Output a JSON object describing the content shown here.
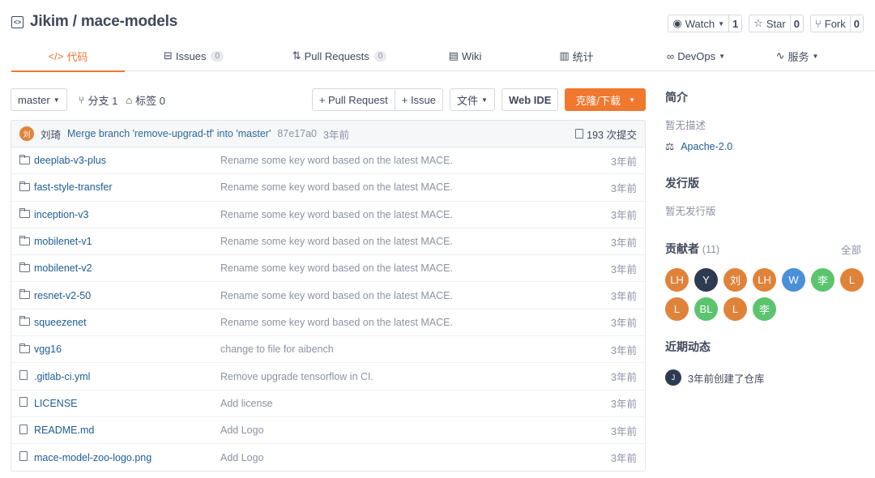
{
  "repo": {
    "title": "Jikim / mace-models",
    "watch_label": "Watch",
    "watch_count": "1",
    "star_label": "Star",
    "star_count": "0",
    "fork_label": "Fork",
    "fork_count": "0"
  },
  "tabs": [
    {
      "icon": "code-icon",
      "label": "代码",
      "badge": ""
    },
    {
      "icon": "issues-icon",
      "label": "Issues",
      "badge": "0"
    },
    {
      "icon": "pull-request-icon",
      "label": "Pull Requests",
      "badge": "0"
    },
    {
      "icon": "wiki-icon",
      "label": "Wiki",
      "badge": ""
    },
    {
      "icon": "stats-icon",
      "label": "统计",
      "badge": ""
    },
    {
      "icon": "devops-icon",
      "label": "DevOps",
      "badge": ""
    },
    {
      "icon": "service-icon",
      "label": "服务",
      "badge": ""
    }
  ],
  "toolbar": {
    "branch": "master",
    "branches_label": "分支 1",
    "tags_label": "标签 0",
    "pull_request_label": "+ Pull Request",
    "issue_label": "+ Issue",
    "file_label": "文件",
    "webide_label": "Web IDE",
    "clone_label": "克隆/下载"
  },
  "commit": {
    "avatar": "刘",
    "author": "刘琦",
    "message": "Merge branch 'remove-upgrad-tf' into 'master'",
    "hash": "87e17a0",
    "time": "3年前",
    "count_label": "193 次提交"
  },
  "files": [
    {
      "type": "folder",
      "name": "deeplab-v3-plus",
      "message": "Rename some key word based on the latest MACE.",
      "time": "3年前"
    },
    {
      "type": "folder",
      "name": "fast-style-transfer",
      "message": "Rename some key word based on the latest MACE.",
      "time": "3年前"
    },
    {
      "type": "folder",
      "name": "inception-v3",
      "message": "Rename some key word based on the latest MACE.",
      "time": "3年前"
    },
    {
      "type": "folder",
      "name": "mobilenet-v1",
      "message": "Rename some key word based on the latest MACE.",
      "time": "3年前"
    },
    {
      "type": "folder",
      "name": "mobilenet-v2",
      "message": "Rename some key word based on the latest MACE.",
      "time": "3年前"
    },
    {
      "type": "folder",
      "name": "resnet-v2-50",
      "message": "Rename some key word based on the latest MACE.",
      "time": "3年前"
    },
    {
      "type": "folder",
      "name": "squeezenet",
      "message": "Rename some key word based on the latest MACE.",
      "time": "3年前"
    },
    {
      "type": "folder",
      "name": "vgg16",
      "message": "change to file for aibench",
      "time": "3年前"
    },
    {
      "type": "file",
      "name": ".gitlab-ci.yml",
      "message": "Remove upgrade tensorflow in CI.",
      "time": "3年前"
    },
    {
      "type": "file",
      "name": "LICENSE",
      "message": "Add license",
      "time": "3年前"
    },
    {
      "type": "file",
      "name": "README.md",
      "message": "Add Logo",
      "time": "3年前"
    },
    {
      "type": "file",
      "name": "mace-model-zoo-logo.png",
      "message": "Add Logo",
      "time": "3年前"
    }
  ],
  "sidebar": {
    "intro_title": "简介",
    "intro_text": "暂无描述",
    "license": "Apache-2.0",
    "release_title": "发行版",
    "release_text": "暂无发行版",
    "contributors_title": "贡献者",
    "contributors_count": "(11)",
    "contributors_all": "全部",
    "contributors": [
      {
        "initials": "LH",
        "color": "#e0833a"
      },
      {
        "initials": "Y",
        "color": "#2e3a4f"
      },
      {
        "initials": "刘",
        "color": "#e0833a"
      },
      {
        "initials": "LH",
        "color": "#e0833a"
      },
      {
        "initials": "W",
        "color": "#4a90d9"
      },
      {
        "initials": "李",
        "color": "#5cc46e"
      },
      {
        "initials": "L",
        "color": "#e0833a"
      },
      {
        "initials": "L",
        "color": "#e0833a"
      },
      {
        "initials": "BL",
        "color": "#5cc46e"
      },
      {
        "initials": "L",
        "color": "#e0833a"
      },
      {
        "initials": "李",
        "color": "#5cc46e"
      }
    ],
    "activity_title": "近期动态",
    "activity_avatar": "J",
    "activity_text": "3年前创建了仓库"
  },
  "colors": {
    "accent": "#f0782f",
    "link": "#1e5c93"
  }
}
